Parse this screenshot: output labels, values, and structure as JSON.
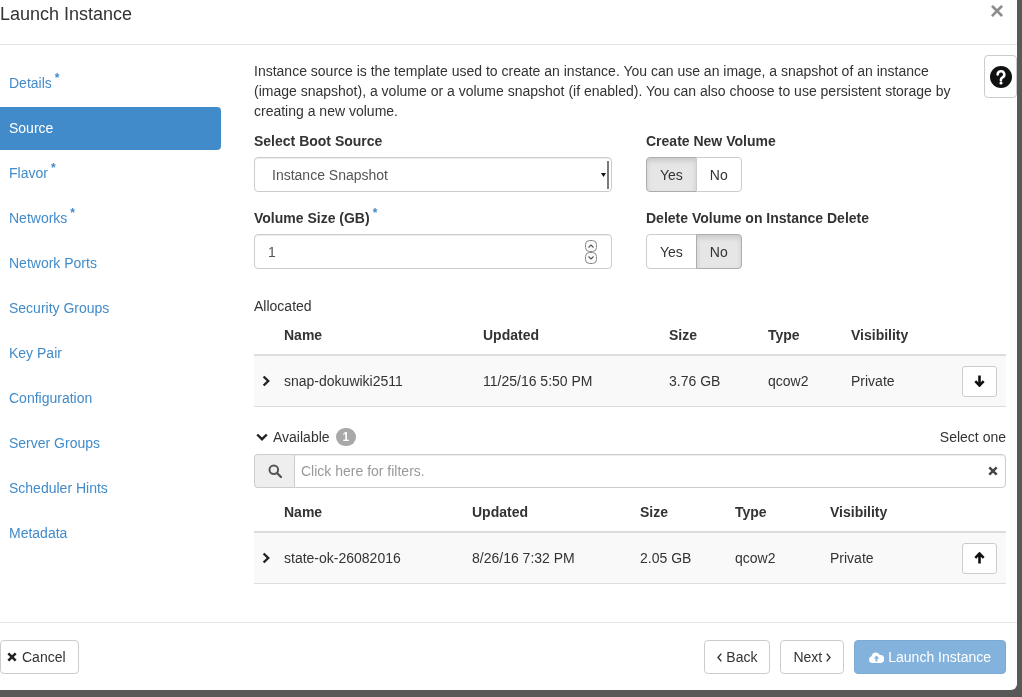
{
  "dialog": {
    "title": "Launch Instance",
    "close": "×"
  },
  "sidebar": {
    "items": [
      {
        "label": "Details",
        "mark": "*",
        "selected": false
      },
      {
        "label": "Source",
        "selected": true
      },
      {
        "label": "Flavor",
        "mark": "*",
        "selected": false
      },
      {
        "label": "Networks",
        "mark": "*",
        "selected": false
      },
      {
        "label": "Network Ports",
        "selected": false
      },
      {
        "label": "Security Groups",
        "selected": false
      },
      {
        "label": "Key Pair",
        "selected": false
      },
      {
        "label": "Configuration",
        "selected": false
      },
      {
        "label": "Server Groups",
        "selected": false
      },
      {
        "label": "Scheduler Hints",
        "selected": false
      },
      {
        "label": "Metadata",
        "selected": false
      }
    ]
  },
  "description": "Instance source is the template used to create an instance. You can use an image, a snapshot of an instance (image snapshot), a volume or a volume snapshot (if enabled). You can also choose to use persistent storage by creating a new volume.",
  "boot_source": {
    "label": "Select Boot Source",
    "value": "Instance Snapshot"
  },
  "create_new_volume": {
    "label": "Create New Volume",
    "options": [
      {
        "label": "Yes",
        "selected": true
      },
      {
        "label": "No",
        "selected": false
      }
    ]
  },
  "volume_size": {
    "label": "Volume Size (GB)",
    "mark": "*",
    "value": "1"
  },
  "delete_volume_on_instance_delete": {
    "label": "Delete Volume on Instance Delete",
    "options": [
      {
        "label": "Yes",
        "selected": false
      },
      {
        "label": "No",
        "selected": true
      }
    ]
  },
  "allocated": {
    "title": "Allocated",
    "columns": [
      "Name",
      "Updated",
      "Size",
      "Type",
      "Visibility"
    ],
    "rows": [
      {
        "expanded": false,
        "cells": [
          "snap-dokuwiki2511",
          "11/25/16 5:50 PM",
          "3.76 GB",
          "qcow2",
          "Private"
        ]
      }
    ]
  },
  "available": {
    "title": "Available",
    "expanded": true,
    "count": "1",
    "hint": "Select one",
    "filter": {
      "placeholder": "Click here for filters."
    },
    "columns": [
      "Name",
      "Updated",
      "Size",
      "Type",
      "Visibility"
    ],
    "rows": [
      {
        "expanded": false,
        "cells": [
          "state-ok-26082016",
          "8/26/16 7:32 PM",
          "2.05 GB",
          "qcow2",
          "Private"
        ]
      }
    ]
  },
  "footer": {
    "buttons": [
      {
        "kind": "cancel",
        "label": "Cancel",
        "disabled": false
      },
      {
        "kind": "back",
        "label": "Back",
        "disabled": false
      },
      {
        "kind": "next",
        "label": "Next",
        "disabled": false
      },
      {
        "kind": "launch",
        "label": "Launch Instance",
        "disabled": true
      }
    ]
  }
}
